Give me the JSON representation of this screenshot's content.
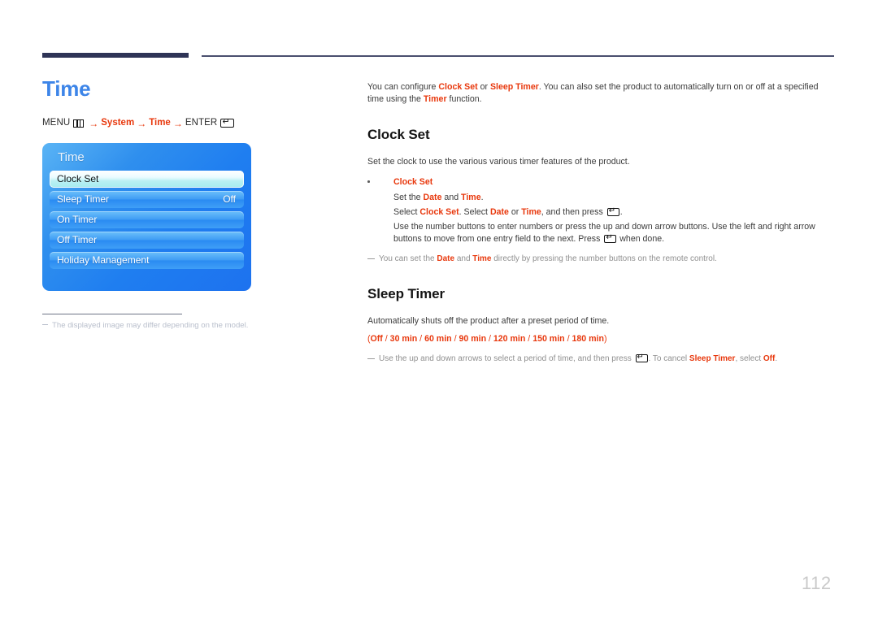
{
  "page": {
    "title": "Time",
    "number": "112"
  },
  "menu_path": {
    "menu_label": "MENU",
    "menu_icon": "menu-grid-icon",
    "arrow": "→",
    "step1": "System",
    "step2": "Time",
    "enter_label": "ENTER",
    "enter_icon": "enter-return-icon"
  },
  "osd": {
    "title": "Time",
    "rows": [
      {
        "label": "Clock Set",
        "value": "",
        "selected": true
      },
      {
        "label": "Sleep Timer",
        "value": "Off",
        "selected": false
      },
      {
        "label": "On Timer",
        "value": "",
        "selected": false
      },
      {
        "label": "Off Timer",
        "value": "",
        "selected": false
      },
      {
        "label": "Holiday Management",
        "value": "",
        "selected": false
      }
    ]
  },
  "left_footnote": {
    "text": "The displayed image may differ depending on the model."
  },
  "intro": {
    "t1": "You can configure ",
    "r1": "Clock Set",
    "t2": " or ",
    "r2": "Sleep Timer",
    "t3": ". You can also set the product to automatically turn on or off at a specified time using the ",
    "r3": "Timer",
    "t4": " function."
  },
  "clock_set": {
    "heading": "Clock Set",
    "intro": "Set the clock to use the various various timer features of the product.",
    "bullet_title": "Clock Set",
    "line1": {
      "t1": "Set the ",
      "r1": "Date",
      "t2": " and ",
      "r2": "Time",
      "t3": "."
    },
    "line2": {
      "t1": "Select ",
      "r1": "Clock Set",
      "t2": ". Select ",
      "r2": "Date",
      "t3": " or ",
      "r3": "Time",
      "t4": ", and then press ",
      "t5": "."
    },
    "line3": "Use the number buttons to enter numbers or press the up and down arrow buttons. Use the left and right arrow buttons to move from one entry field to the next. Press ",
    "line3b": " when done.",
    "note": {
      "t1": "You can set the ",
      "r1": "Date",
      "t2": " and ",
      "r2": "Time",
      "t3": " directly by pressing the number buttons on the remote control."
    }
  },
  "sleep_timer": {
    "heading": "Sleep Timer",
    "intro": "Automatically shuts off the product after a preset period of time.",
    "options": [
      "Off",
      "30 min",
      "60 min",
      "90 min",
      "120 min",
      "150 min",
      "180 min"
    ],
    "options_open": "(",
    "options_close": ")",
    "options_sep": " / ",
    "note": {
      "t1": "Use the up and down arrows to select a period of time, and then press ",
      "t2": ". To cancel ",
      "r1": "Sleep Timer",
      "t3": ", select ",
      "r2": "Off",
      "t4": "."
    }
  },
  "colors": {
    "accent_blue": "#3d85e8",
    "accent_red": "#e8380d",
    "rule_navy": "#2e3456",
    "osd_blue": "#1f7ef0",
    "page_number_gray": "#c9c9c9"
  }
}
